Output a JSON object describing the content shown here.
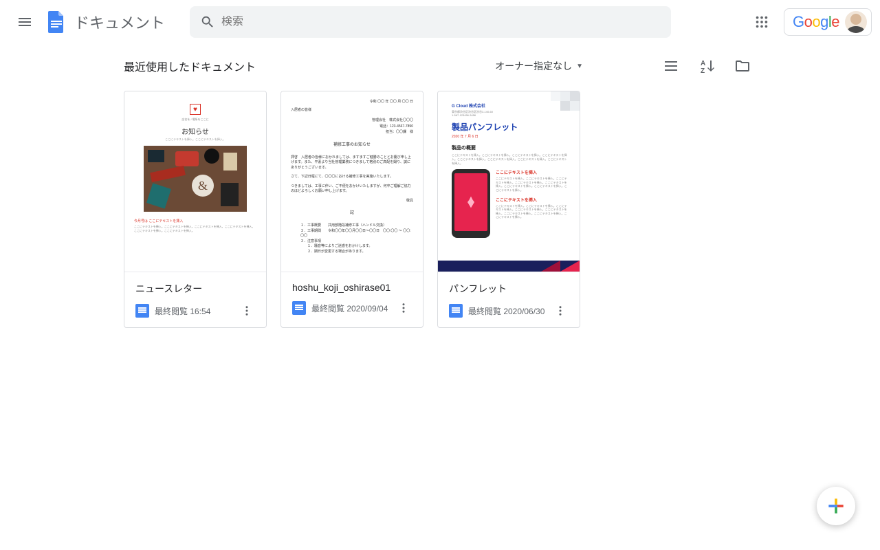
{
  "header": {
    "app_title": "ドキュメント",
    "search_placeholder": "検索",
    "google_label": "Google"
  },
  "toolbar": {
    "section_title": "最近使用したドキュメント",
    "owner_filter_label": "オーナー指定なし"
  },
  "documents": [
    {
      "title": "ニュースレター",
      "meta": "最終閲覧 16:54",
      "thumb": {
        "subtitle": "店名を / 場所をここに",
        "title": "お知らせ",
        "line": "ここにテキストを挿入。ここにテキストを挿入。",
        "footer_head": "今月号は ここにテキストを挿入",
        "footer_body": "ここにテキストを挿入。ここにテキストを挿入。ここにテキストを挿入。ここにテキストを挿入。ここにテキストを挿入。ここにテキストを挿入。"
      }
    },
    {
      "title": "hoshu_koji_oshirase01",
      "meta": "最終閲覧 2020/09/04",
      "thumb": {
        "date": "令和 〇〇 年 〇〇 月 〇〇 日",
        "to": "入居者の皆様",
        "from1": "管理会社　株式会社〇〇〇",
        "from2": "電話：123-4567-7890",
        "from3": "担当：〇〇課　様",
        "title": "補修工事のお知らせ",
        "greet": "拝啓　入居者の皆様におかれましては、ますますご健勝のこととお慶び申し上げます。また、平素より当社管理業務につきまして格別のご高配を賜り、誠にありがとうございます。",
        "body1": "さて、下記日程にて、〇〇〇における補修工事を実施いたします。",
        "body2": "つきましては、工事に伴い、ご不便をおかけいたしますが、何卒ご理解ご協力のほどよろしくお願い申し上げます。",
        "sign": "敬具",
        "rec": "記",
        "li1_k": "１．工事概要",
        "li1_v": "共用部階段補修工事（ハンドル交換）",
        "li2_k": "２．工事期間",
        "li2_v": "令和〇〇年〇〇月〇〇日～〇〇日　〇〇:〇〇 ～ 〇〇:〇〇",
        "li3_k": "３．注意事項",
        "li3_v1": "１．騒音等によりご迷惑をおかけします。",
        "li3_v2": "２．期日が変更する場合があります。"
      }
    },
    {
      "title": "パンフレット",
      "meta": "最終閲覧 2020/06/30",
      "thumb": {
        "company": "G Cloud 株式会社",
        "addr1": "東京都渋谷区渋谷区渋谷3-140-60",
        "addr2": "1-567-123456-3456",
        "product_title": "製品パンフレット",
        "date": "2020 年 7 月 6 日",
        "overview_h": "製品の概要",
        "para": "ここにテキストを挿入。ここにテキストを挿入。ここにテキストを挿入。ここにテキストを挿入。ここにテキストを挿入。ここにテキストを挿入。ここにテキストを挿入。ここにテキストを挿入。",
        "rh1": "ここにテキストを挿入",
        "rh2": "ここにテキストを挿入"
      }
    }
  ]
}
